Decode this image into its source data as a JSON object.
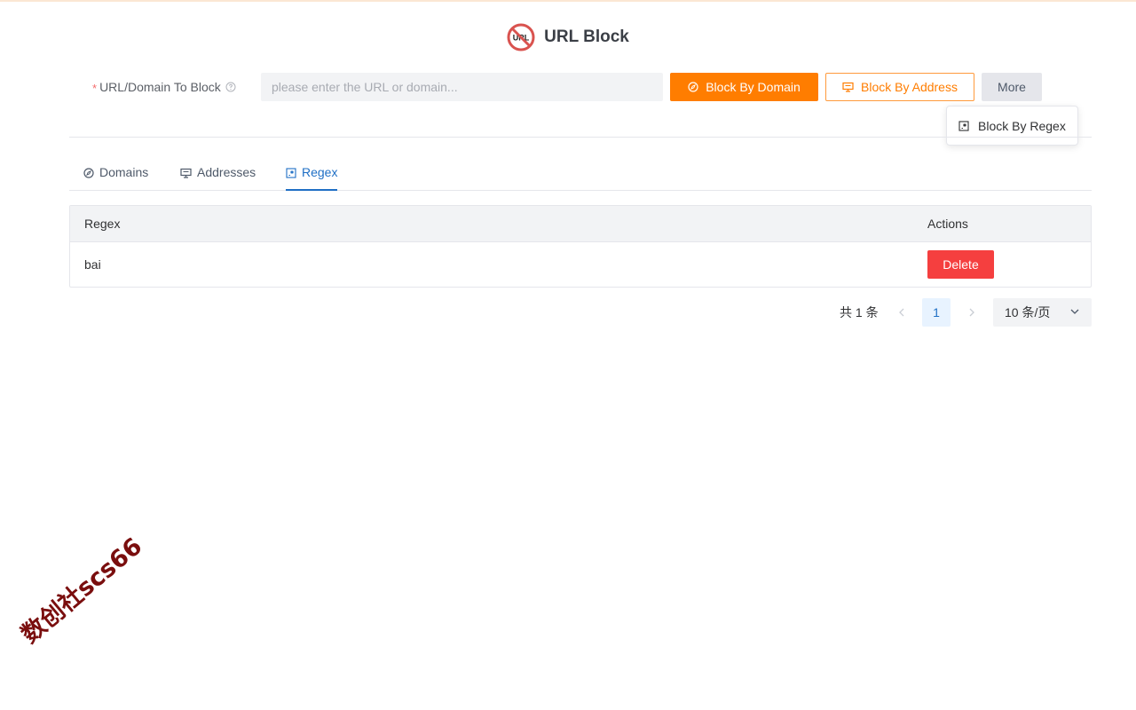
{
  "header": {
    "title": "URL Block",
    "logo_text": "URL"
  },
  "form": {
    "required_mark": "*",
    "label": "URL/Domain To Block",
    "input_value": "",
    "input_placeholder": "please enter the URL or domain..."
  },
  "actions": {
    "block_by_domain": "Block By Domain",
    "block_by_address": "Block By Address",
    "more": "More"
  },
  "dropdown": {
    "items": [
      "Block By Regex"
    ]
  },
  "tabs": [
    {
      "label": "Domains",
      "active": false
    },
    {
      "label": "Addresses",
      "active": false
    },
    {
      "label": "Regex",
      "active": true
    }
  ],
  "table": {
    "columns": [
      "Regex",
      "Actions"
    ],
    "rows": [
      {
        "regex": "bai",
        "action": "Delete"
      }
    ]
  },
  "pagination": {
    "total": "共 1 条",
    "current_page": "1",
    "page_size": "10 条/页"
  },
  "watermark": "数创社scs66",
  "colors": {
    "accent_orange": "#ff7d00",
    "link_blue": "#1f6fc5",
    "danger_red": "#f53f3f",
    "logo_red": "#d9534f"
  }
}
